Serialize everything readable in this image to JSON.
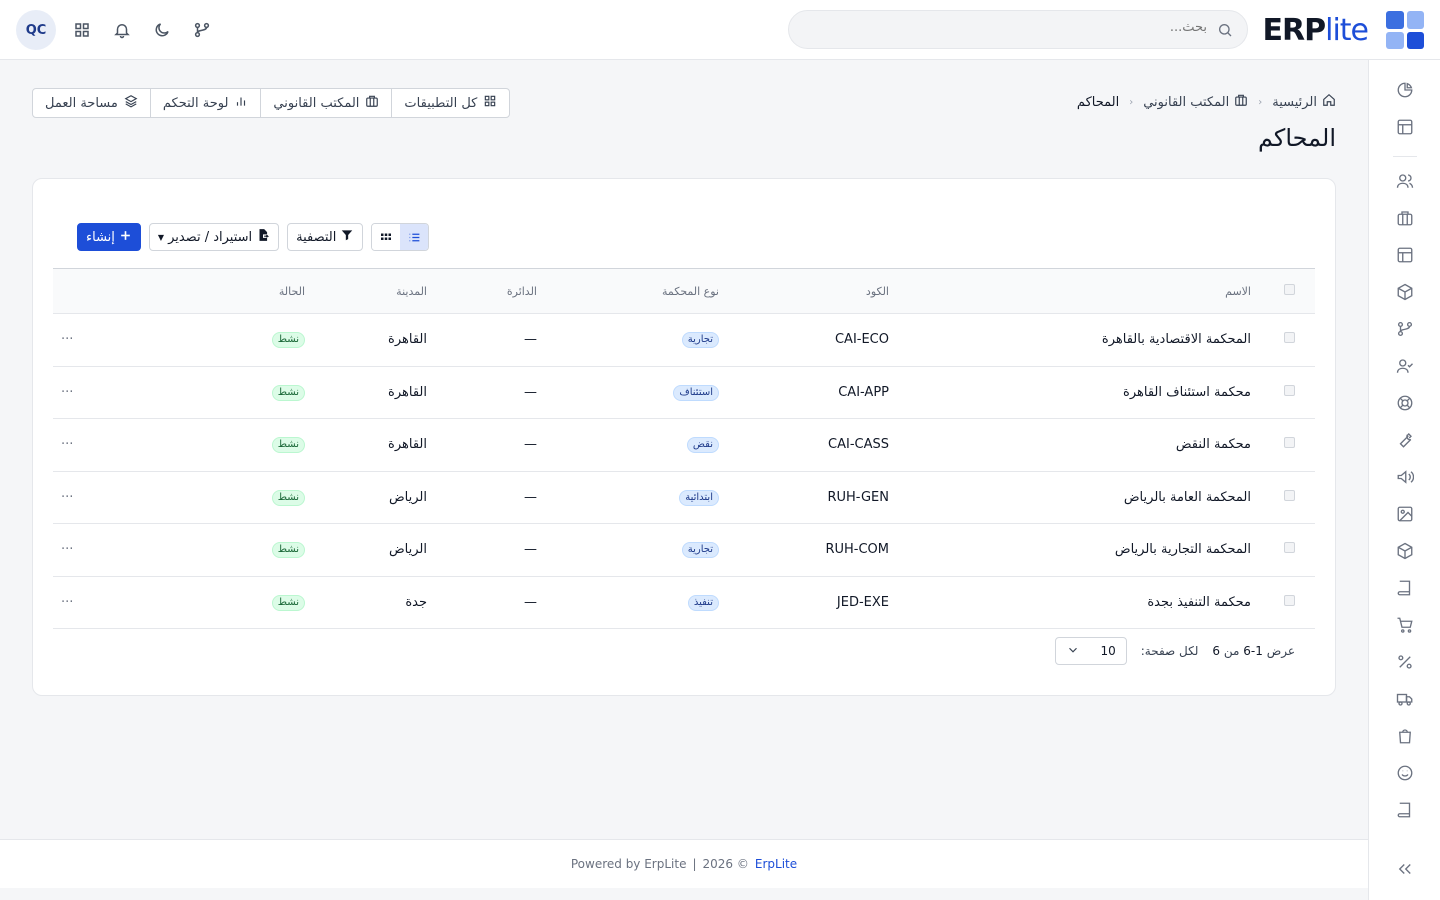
{
  "brand": {
    "name_bold": "ERP",
    "name_light": "lite",
    "colors": [
      "#3b6fe0",
      "#1d4ed8",
      "#60a5fa",
      "#1e40af"
    ]
  },
  "search": {
    "placeholder": "بحث..."
  },
  "user": {
    "initials": "QC"
  },
  "topbar_icons": [
    "apps-icon",
    "bell-icon",
    "moon-icon",
    "git-branch-icon"
  ],
  "breadcrumb": {
    "home": "الرئيسية",
    "section": "المكتب القانوني",
    "current": "المحاكم"
  },
  "page": {
    "title": "المحاكم"
  },
  "quick_links": [
    {
      "label": "كل التطبيقات",
      "icon": "grid-icon"
    },
    {
      "label": "المكتب القانوني",
      "icon": "briefcase-icon"
    },
    {
      "label": "لوحة التحكم",
      "icon": "bar-chart-icon"
    },
    {
      "label": "مساحة العمل",
      "icon": "layers-icon"
    }
  ],
  "toolbar": {
    "create": "إنشاء",
    "import_export": "استيراد / تصدير",
    "filter": "التصفية"
  },
  "table": {
    "columns": {
      "name": "الاسم",
      "code": "الكود",
      "type": "نوع المحكمة",
      "circuit": "الدائرة",
      "city": "المدينة",
      "status": "الحالة"
    },
    "rows": [
      {
        "name": "المحكمة الاقتصادية بالقاهرة",
        "code": "CAI-ECO",
        "type": "تجارية",
        "circuit": "—",
        "city": "القاهرة",
        "status": "نشط",
        "actions": "···"
      },
      {
        "name": "محكمة استئناف القاهرة",
        "code": "CAI-APP",
        "type": "استئناف",
        "circuit": "—",
        "city": "القاهرة",
        "status": "نشط",
        "actions": "···"
      },
      {
        "name": "محكمة النقض",
        "code": "CAI-CASS",
        "type": "نقض",
        "circuit": "—",
        "city": "القاهرة",
        "status": "نشط",
        "actions": "···"
      },
      {
        "name": "المحكمة العامة بالرياض",
        "code": "RUH-GEN",
        "type": "ابتدائية",
        "circuit": "—",
        "city": "الرياض",
        "status": "نشط",
        "actions": "···"
      },
      {
        "name": "المحكمة التجارية بالرياض",
        "code": "RUH-COM",
        "type": "تجارية",
        "circuit": "—",
        "city": "الرياض",
        "status": "نشط",
        "actions": "···"
      },
      {
        "name": "محكمة التنفيذ بجدة",
        "code": "JED-EXE",
        "type": "تنفيذ",
        "circuit": "—",
        "city": "جدة",
        "status": "نشط",
        "actions": "···"
      }
    ]
  },
  "pagination": {
    "showing_prefix": "عرض",
    "range": "1-6",
    "of_word": "من",
    "total": "6",
    "per_page_label": "لكل صفحة:",
    "per_page_value": "10"
  },
  "footer": {
    "powered": "Powered by ErpLite",
    "sep": "|",
    "year": "2026 ©",
    "link": "ErpLite"
  },
  "sidebar_icons": [
    "pie-chart-icon",
    "layout-icon",
    "users-icon",
    "briefcase-icon",
    "layout-icon",
    "box-icon",
    "git-branch-icon",
    "user-check-icon",
    "lifebuoy-icon",
    "wrench-icon",
    "megaphone-icon",
    "image-icon",
    "package-icon",
    "book-icon",
    "cart-icon",
    "percent-icon",
    "truck-icon",
    "shopping-bag-icon",
    "smile-icon",
    "book-icon",
    "chevrons-left-icon"
  ]
}
